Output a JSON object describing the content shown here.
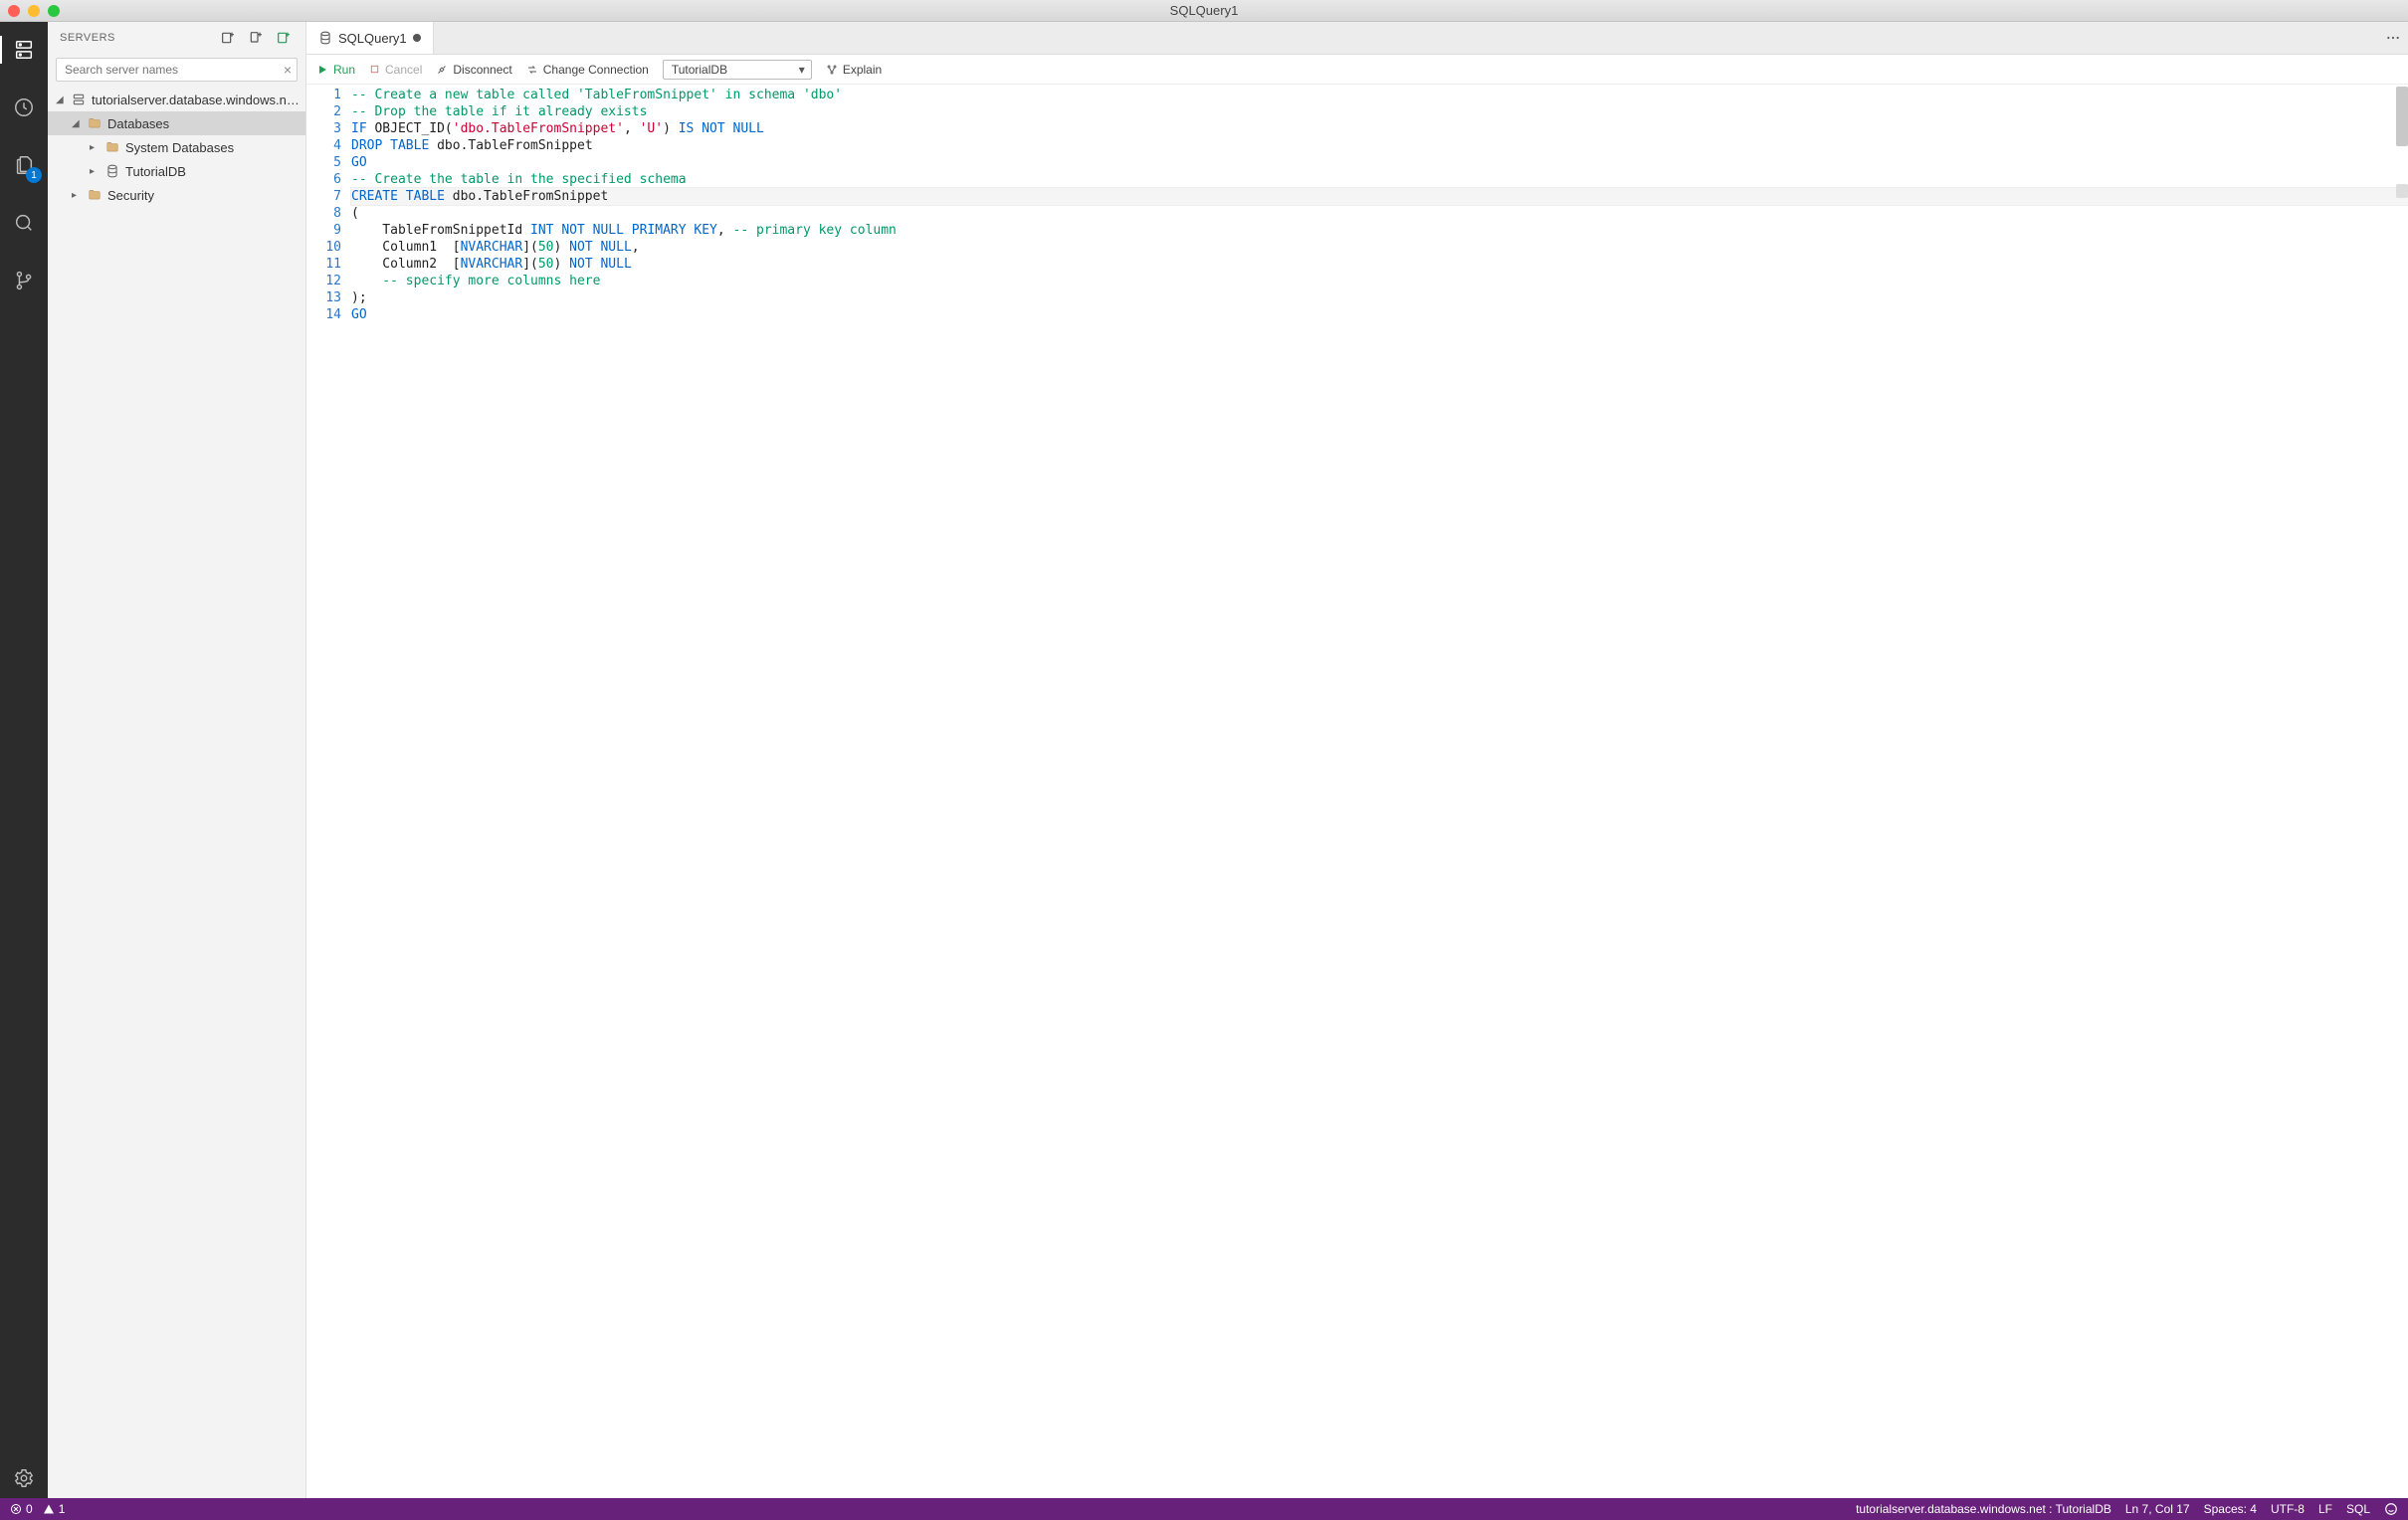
{
  "window": {
    "title": "SQLQuery1"
  },
  "activitybar": {
    "items": [
      {
        "name": "servers",
        "active": true
      },
      {
        "name": "history",
        "active": false
      },
      {
        "name": "explorer",
        "active": false,
        "badge": "1"
      },
      {
        "name": "search",
        "active": false
      },
      {
        "name": "source-control",
        "active": false
      }
    ],
    "settings_name": "settings"
  },
  "sidebar": {
    "title": "SERVERS",
    "search_placeholder": "Search server names",
    "tree": {
      "server": "tutorialserver.database.windows.n…",
      "databases_label": "Databases",
      "system_databases_label": "System Databases",
      "user_db": "TutorialDB",
      "security_label": "Security"
    }
  },
  "tabs": {
    "items": [
      {
        "label": "SQLQuery1",
        "dirty": true
      }
    ]
  },
  "toolbar": {
    "run_label": "Run",
    "cancel_label": "Cancel",
    "disconnect_label": "Disconnect",
    "change_connection_label": "Change Connection",
    "database_selected": "TutorialDB",
    "explain_label": "Explain"
  },
  "editor": {
    "active_line": 7,
    "cursor_col": 17,
    "lines": [
      [
        [
          "comment",
          "-- Create a new table called 'TableFromSnippet' in schema 'dbo'"
        ]
      ],
      [
        [
          "comment",
          "-- Drop the table if it already exists"
        ]
      ],
      [
        [
          "kw",
          "IF"
        ],
        [
          "plain",
          " OBJECT_ID("
        ],
        [
          "str",
          "'dbo.TableFromSnippet'"
        ],
        [
          "plain",
          ", "
        ],
        [
          "str",
          "'U'"
        ],
        [
          "plain",
          ") "
        ],
        [
          "kw",
          "IS NOT NULL"
        ]
      ],
      [
        [
          "kw",
          "DROP TABLE"
        ],
        [
          "plain",
          " dbo.TableFromSnippet"
        ]
      ],
      [
        [
          "kw",
          "GO"
        ]
      ],
      [
        [
          "comment",
          "-- Create the table in the specified schema"
        ]
      ],
      [
        [
          "kw",
          "CREATE TABLE"
        ],
        [
          "plain",
          " dbo.TableFromSnippet"
        ]
      ],
      [
        [
          "plain",
          "("
        ]
      ],
      [
        [
          "plain",
          "    TableFromSnippetId "
        ],
        [
          "kw",
          "INT NOT NULL PRIMARY KEY"
        ],
        [
          "plain",
          ", "
        ],
        [
          "comment",
          "-- primary key column"
        ]
      ],
      [
        [
          "plain",
          "    Column1  ["
        ],
        [
          "kw",
          "NVARCHAR"
        ],
        [
          "plain",
          "]("
        ],
        [
          "num",
          "50"
        ],
        [
          "plain",
          ") "
        ],
        [
          "kw",
          "NOT NULL"
        ],
        [
          "plain",
          ","
        ]
      ],
      [
        [
          "plain",
          "    Column2  ["
        ],
        [
          "kw",
          "NVARCHAR"
        ],
        [
          "plain",
          "]("
        ],
        [
          "num",
          "50"
        ],
        [
          "plain",
          ") "
        ],
        [
          "kw",
          "NOT NULL"
        ]
      ],
      [
        [
          "comment",
          "    -- specify more columns here"
        ]
      ],
      [
        [
          "plain",
          ");"
        ]
      ],
      [
        [
          "kw",
          "GO"
        ]
      ]
    ]
  },
  "statusbar": {
    "errors": "0",
    "warnings": "1",
    "connection": "tutorialserver.database.windows.net : TutorialDB",
    "cursor": "Ln 7, Col 17",
    "spaces": "Spaces: 4",
    "encoding": "UTF-8",
    "eol": "LF",
    "language": "SQL"
  }
}
